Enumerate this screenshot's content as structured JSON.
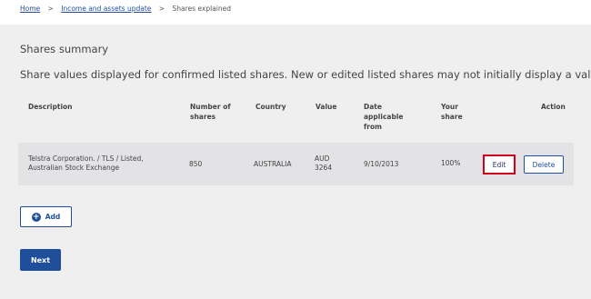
{
  "breadcrumb": {
    "home": "Home",
    "income_assets": "Income and assets update",
    "current": "Shares explained",
    "separator": ">"
  },
  "summary": {
    "title": "Shares summary",
    "text": "Share values displayed for confirmed listed shares. New or edited listed shares may not initially display a value."
  },
  "table": {
    "headers": {
      "description": "Description",
      "number_1": "Number of",
      "number_2": "shares",
      "country": "Country",
      "value": "Value",
      "date_1": "Date",
      "date_2": "applicable",
      "date_3": "from",
      "share_1": "Your",
      "share_2": "share",
      "action": "Action"
    },
    "rows": [
      {
        "description_1": "Telstra Corporation. / TLS / Listed,",
        "description_2": "Australian Stock Exchange",
        "number": "850",
        "country": "AUSTRALIA",
        "value_1": "AUD",
        "value_2": "3264",
        "date": "9/10/2013",
        "share": "100%",
        "edit_label": "Edit",
        "delete_label": "Delete"
      }
    ]
  },
  "buttons": {
    "add_label": "Add",
    "add_icon": "plus-circle-icon",
    "next_label": "Next"
  },
  "colors": {
    "primary": "#1f4e9a",
    "highlight": "#d0021b"
  }
}
